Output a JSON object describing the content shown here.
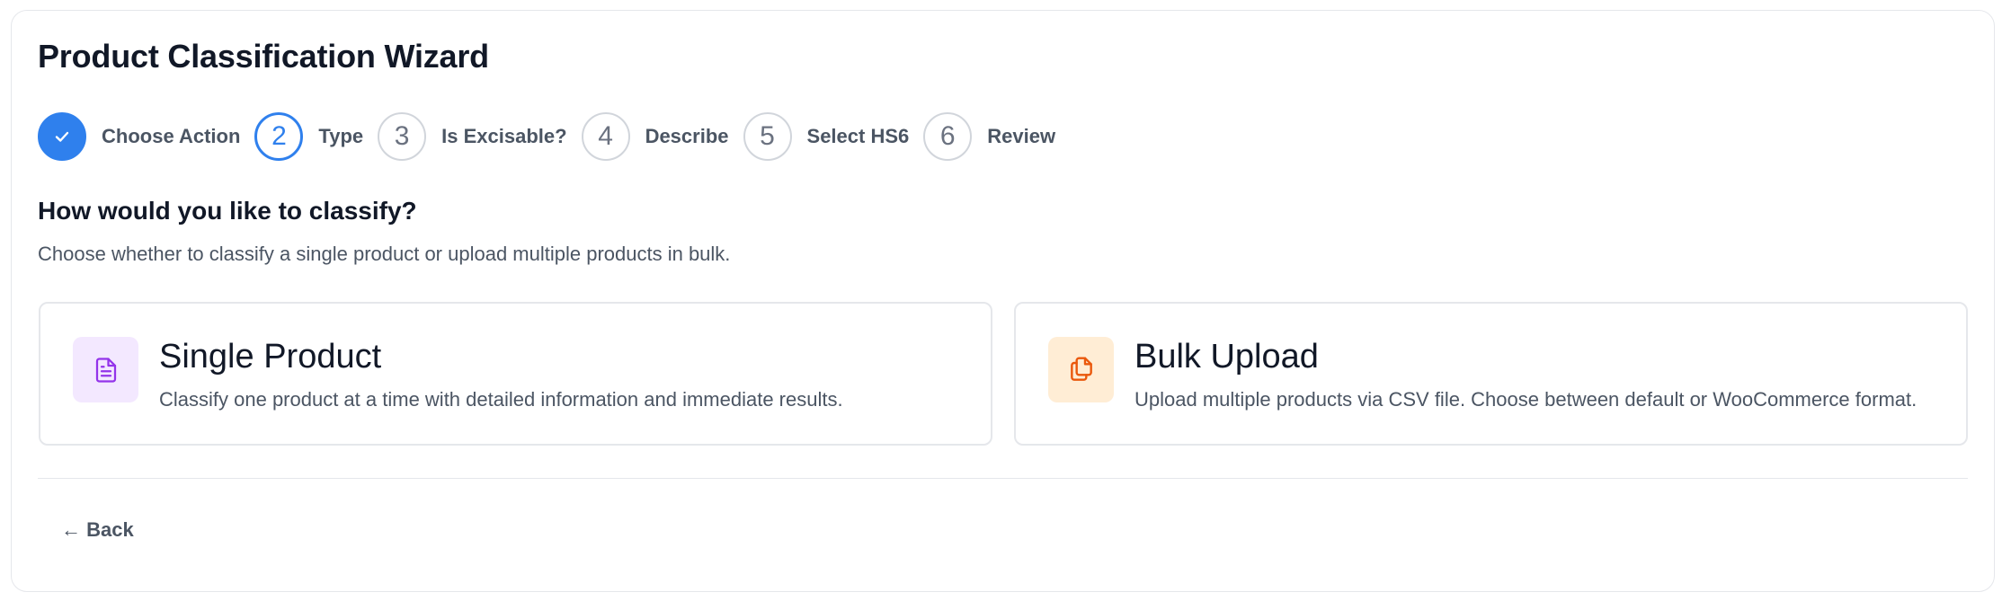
{
  "wizard": {
    "title": "Product Classification Wizard"
  },
  "stepper": {
    "steps": [
      {
        "number": "",
        "label": "Choose Action",
        "state": "complete"
      },
      {
        "number": "2",
        "label": "Type",
        "state": "active"
      },
      {
        "number": "3",
        "label": "Is Excisable?",
        "state": "upcoming"
      },
      {
        "number": "4",
        "label": "Describe",
        "state": "upcoming"
      },
      {
        "number": "5",
        "label": "Select HS6",
        "state": "upcoming"
      },
      {
        "number": "6",
        "label": "Review",
        "state": "upcoming"
      }
    ]
  },
  "main": {
    "heading": "How would you like to classify?",
    "subheading": "Choose whether to classify a single product or upload multiple products in bulk.",
    "options": [
      {
        "title": "Single Product",
        "description": "Classify one product at a time with detailed information and immediate results.",
        "icon": "document-icon",
        "icon_color": "#9333ea",
        "icon_bg": "#f3e8ff"
      },
      {
        "title": "Bulk Upload",
        "description": "Upload multiple products via CSV file. Choose between default or WooCommerce format.",
        "icon": "copy-files-icon",
        "icon_color": "#ea580c",
        "icon_bg": "#ffedd5"
      }
    ]
  },
  "footer": {
    "back_label": "← Back"
  },
  "colors": {
    "accent": "#2f80ed",
    "border": "#e5e7eb"
  }
}
